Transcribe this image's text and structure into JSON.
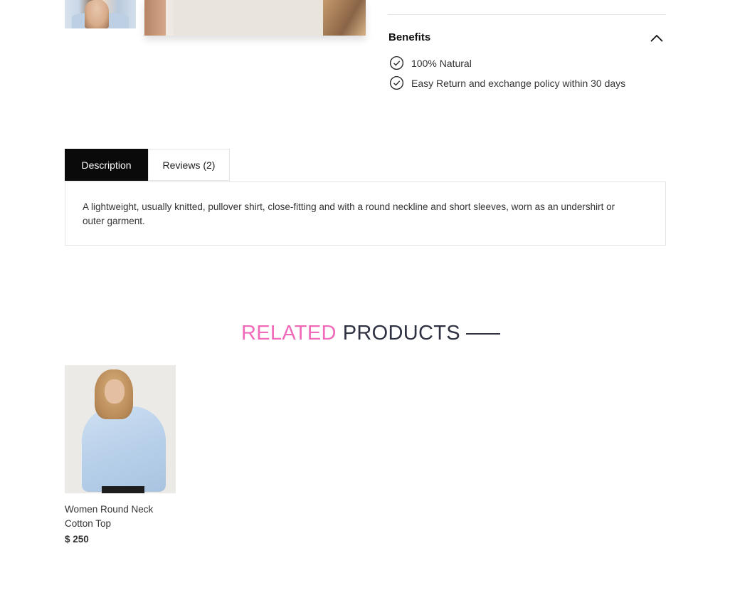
{
  "benefits": {
    "title": "Benefits",
    "items": [
      "100% Natural",
      "Easy Return and exchange policy within 30 days"
    ]
  },
  "tabs": {
    "description_label": "Description",
    "reviews_label": "Reviews (2)"
  },
  "description": {
    "text": "A lightweight, usually knitted, pullover shirt, close-fitting and with a round neckline and short sleeves, worn as an undershirt or outer garment."
  },
  "related": {
    "title_accent": "RELATED",
    "title_main": "PRODUCTS"
  },
  "products": [
    {
      "name": "Women Round Neck Cotton Top",
      "price": "$ 250"
    }
  ],
  "colors": {
    "accent": "#f06aba",
    "title_dark": "#2d3142",
    "active_tab_bg": "#0a0a0a"
  },
  "icons": {
    "check": "check-circle-icon",
    "collapse": "chevron-up-icon"
  }
}
